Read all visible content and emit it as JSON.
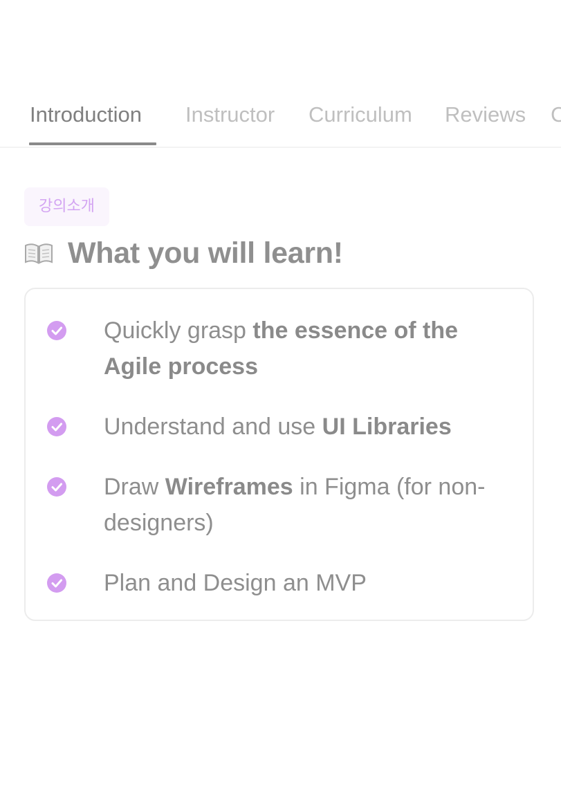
{
  "tabs": [
    {
      "label": "Introduction"
    },
    {
      "label": "Instructor"
    },
    {
      "label": "Curriculum"
    },
    {
      "label": "Reviews"
    },
    {
      "label": "C"
    }
  ],
  "section": {
    "badge": "강의소개",
    "icon": "open-book-icon",
    "title": "What you will learn!"
  },
  "learn_items": [
    {
      "pre": "Quickly grasp ",
      "bold": "the essence of the Agile process",
      "post": ""
    },
    {
      "pre": "Understand and use ",
      "bold": "UI Libraries",
      "post": ""
    },
    {
      "pre": "Draw ",
      "bold": "Wireframes",
      "post": " in Figma (for non-designers)"
    },
    {
      "pre": "Plan and Design an MVP",
      "bold": "",
      "post": ""
    }
  ],
  "colors": {
    "accent": "#d39cf0",
    "text": "#8e8e8e",
    "tab_inactive": "#bfbfbf",
    "badge_bg": "#faf5fd"
  }
}
